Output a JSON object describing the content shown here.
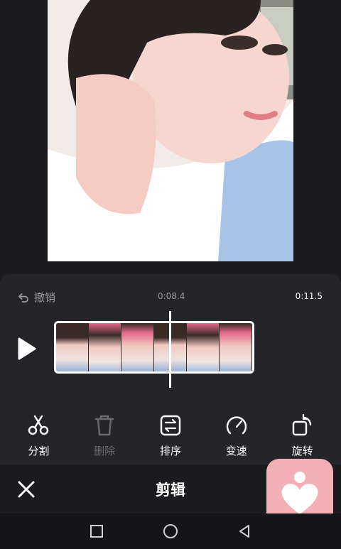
{
  "preview": {
    "image": "photo-preview"
  },
  "editor": {
    "undo_label": "撤销",
    "current_time": "0:08.4",
    "total_time": "0:11.5",
    "tools": [
      {
        "label": "分割",
        "icon": "scissors-icon",
        "enabled": true
      },
      {
        "label": "删除",
        "icon": "trash-icon",
        "enabled": false
      },
      {
        "label": "排序",
        "icon": "sort-icon",
        "enabled": true
      },
      {
        "label": "变速",
        "icon": "speed-icon",
        "enabled": true
      },
      {
        "label": "旋转",
        "icon": "rotate-icon",
        "enabled": true
      }
    ],
    "title": "剪辑"
  },
  "colors": {
    "background": "#1c1c20",
    "panel": "#252529",
    "badge": "#f3b0b6",
    "disabled_text": "#6a6a70"
  }
}
